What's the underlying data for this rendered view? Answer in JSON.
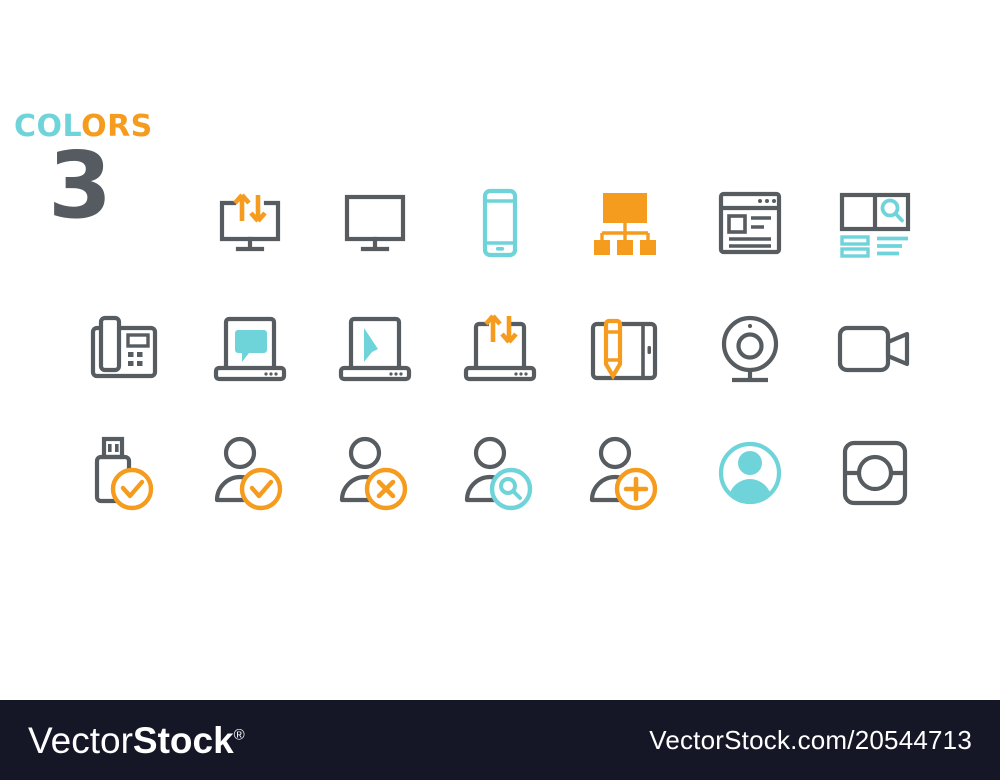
{
  "palette": {
    "gray": "#575c61",
    "orange": "#f59c1e",
    "teal": "#6fd4da",
    "footer_bg": "#151726",
    "page_bg": "#ffffff"
  },
  "badge": {
    "word_part_1": "COL",
    "word_part_2": "ORS",
    "count": "3"
  },
  "grid": {
    "columns": 7,
    "rows": 3,
    "icons": [
      {
        "name": "monitor-data-transfer-icon",
        "label": "Monitor with upload download arrows",
        "row": 1,
        "col": 2,
        "colors": [
          "gray",
          "orange"
        ]
      },
      {
        "name": "monitor-icon",
        "label": "Desktop monitor",
        "row": 1,
        "col": 3,
        "colors": [
          "gray"
        ]
      },
      {
        "name": "smartphone-icon",
        "label": "Smartphone",
        "row": 1,
        "col": 4,
        "colors": [
          "teal"
        ]
      },
      {
        "name": "sitemap-icon",
        "label": "Site map hierarchy",
        "row": 1,
        "col": 5,
        "colors": [
          "orange"
        ]
      },
      {
        "name": "browser-window-layout-icon",
        "label": "Browser window with content layout",
        "row": 1,
        "col": 6,
        "colors": [
          "gray"
        ]
      },
      {
        "name": "search-layout-icon",
        "label": "Page layout with search",
        "row": 1,
        "col": 7,
        "colors": [
          "gray",
          "teal"
        ]
      },
      {
        "name": "desk-phone-icon",
        "label": "Office desk telephone",
        "row": 2,
        "col": 1,
        "colors": [
          "gray"
        ]
      },
      {
        "name": "laptop-chat-icon",
        "label": "Laptop with chat bubble",
        "row": 2,
        "col": 2,
        "colors": [
          "gray",
          "teal"
        ]
      },
      {
        "name": "laptop-cursor-icon",
        "label": "Laptop with pointer cursor",
        "row": 2,
        "col": 3,
        "colors": [
          "gray",
          "teal"
        ]
      },
      {
        "name": "laptop-data-transfer-icon",
        "label": "Laptop with upload download arrows",
        "row": 2,
        "col": 4,
        "colors": [
          "gray",
          "orange"
        ]
      },
      {
        "name": "tablet-stylus-icon",
        "label": "Tablet with stylus pencil",
        "row": 2,
        "col": 5,
        "colors": [
          "gray",
          "orange"
        ]
      },
      {
        "name": "webcam-icon",
        "label": "Webcam on stand",
        "row": 2,
        "col": 6,
        "colors": [
          "gray"
        ]
      },
      {
        "name": "video-camera-icon",
        "label": "Video camera",
        "row": 2,
        "col": 7,
        "colors": [
          "gray"
        ]
      },
      {
        "name": "usb-drive-verified-icon",
        "label": "USB flash drive with checkmark",
        "row": 3,
        "col": 1,
        "colors": [
          "gray",
          "orange"
        ]
      },
      {
        "name": "user-verified-icon",
        "label": "User with checkmark",
        "row": 3,
        "col": 2,
        "colors": [
          "gray",
          "orange"
        ]
      },
      {
        "name": "user-remove-icon",
        "label": "User with cross",
        "row": 3,
        "col": 3,
        "colors": [
          "gray",
          "orange"
        ]
      },
      {
        "name": "user-search-icon",
        "label": "User with magnifier",
        "row": 3,
        "col": 4,
        "colors": [
          "gray",
          "teal"
        ]
      },
      {
        "name": "user-add-icon",
        "label": "User with plus",
        "row": 3,
        "col": 5,
        "colors": [
          "gray",
          "orange"
        ]
      },
      {
        "name": "user-avatar-circle-icon",
        "label": "User avatar in circle",
        "row": 3,
        "col": 6,
        "colors": [
          "teal"
        ]
      },
      {
        "name": "contact-card-icon",
        "label": "Contact card with portrait",
        "row": 3,
        "col": 7,
        "colors": [
          "gray"
        ]
      }
    ]
  },
  "footer": {
    "brand_light": "Vector",
    "brand_bold": "Stock",
    "brand_registered": "®",
    "url": "VectorStock.com/20544713"
  }
}
